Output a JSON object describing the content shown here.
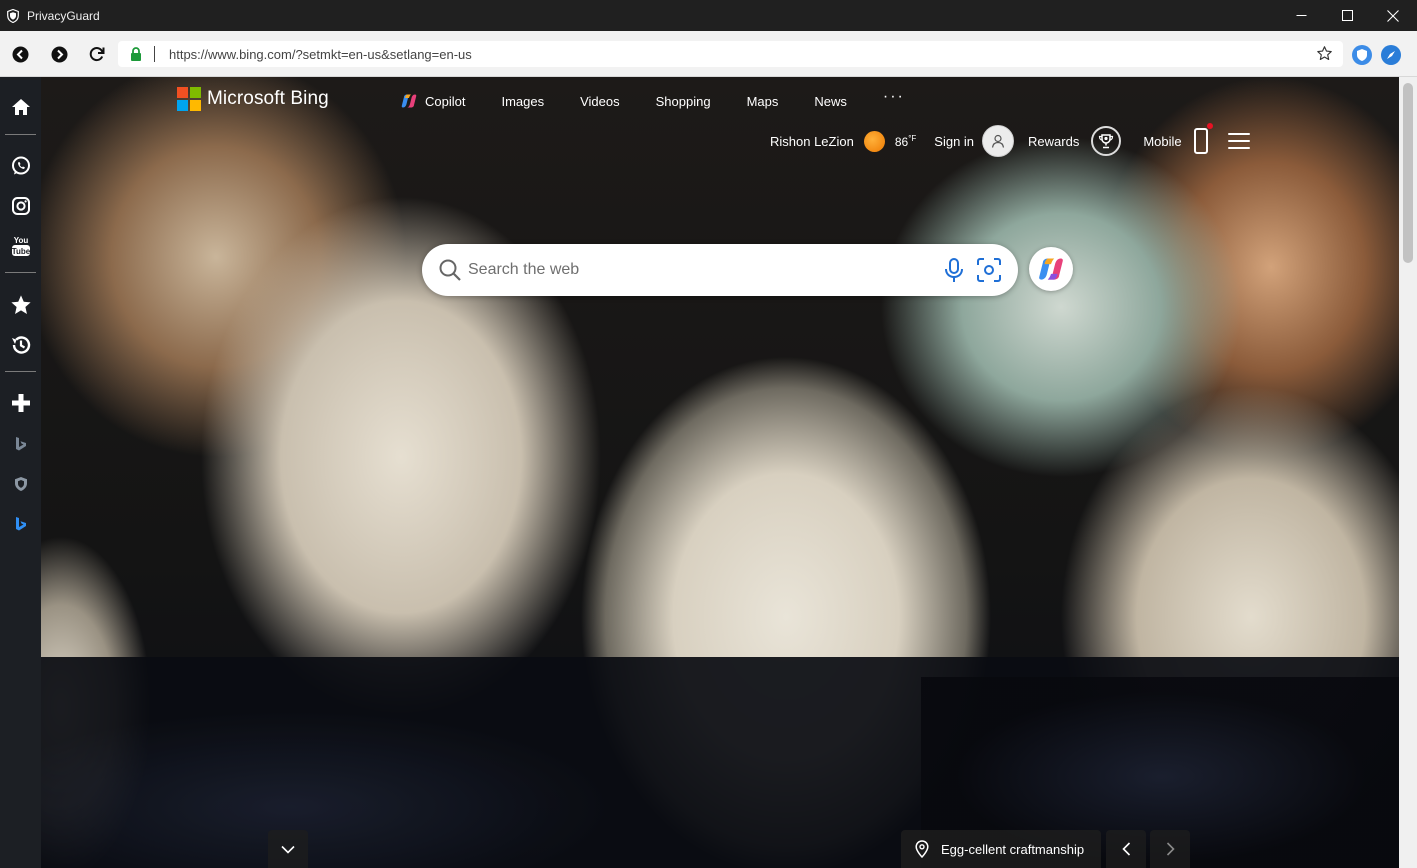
{
  "window": {
    "title": "PrivacyGuard",
    "controls": [
      "minimize",
      "maximize",
      "close"
    ]
  },
  "toolbar": {
    "url": "https://www.bing.com/?setmkt=en-us&setlang=en-us",
    "icons": [
      "back-icon",
      "forward-icon",
      "reload-icon",
      "lock-icon",
      "bookmark-star-icon",
      "extension-shield-icon",
      "extension-compass-icon"
    ]
  },
  "sidebar": {
    "items": [
      "home-icon",
      "whatsapp-icon",
      "instagram-icon",
      "youtube-icon",
      "favorites-star-icon",
      "history-icon",
      "add-icon",
      "bing-icon",
      "privacyguard-shield-icon",
      "bing-blue-icon"
    ]
  },
  "bing": {
    "logo_text": "Microsoft Bing",
    "nav": {
      "copilot": "Copilot",
      "images": "Images",
      "videos": "Videos",
      "shopping": "Shopping",
      "maps": "Maps",
      "news": "News",
      "more": "···"
    },
    "location": "Rishon LeZion",
    "temperature": "86",
    "temp_unit": "°F",
    "sign_in": "Sign in",
    "rewards": "Rewards",
    "mobile": "Mobile",
    "search_placeholder": "Search the web",
    "image_caption": "Egg-cellent craftmanship"
  },
  "colors": {
    "ms_red": "#f25022",
    "ms_green": "#7fba00",
    "ms_blue": "#00a4ef",
    "ms_yellow": "#ffb900",
    "sidebar_bg": "#1c1f24",
    "titlebar_bg": "#202020"
  }
}
